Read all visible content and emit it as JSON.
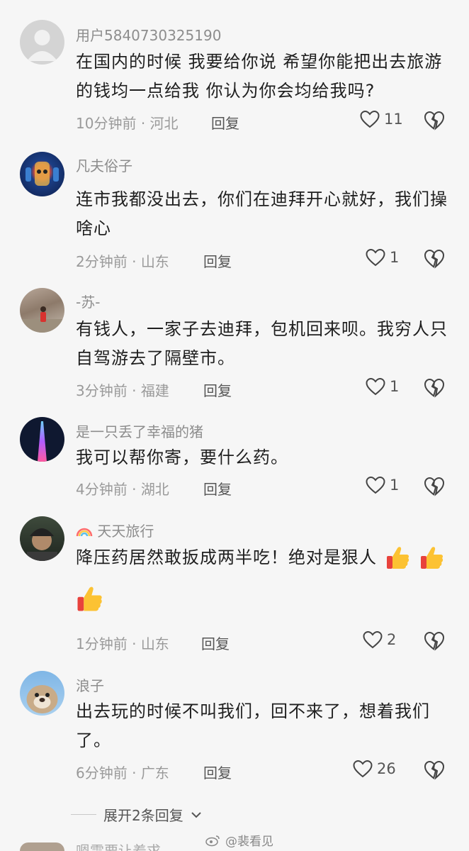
{
  "comments": [
    {
      "user": "用户5840730325190",
      "text": "在国内的时候  我要给你说  希望你能把出去旅游的钱均一点给我  你认为你会均给我吗?",
      "time": "10分钟前",
      "location": "河北",
      "reply": "回复",
      "likes": "11"
    },
    {
      "user": "凡夫俗子",
      "text": "连市我都没出去，你们在迪拜开心就好，我们操啥心",
      "time": "2分钟前",
      "location": "山东",
      "reply": "回复",
      "likes": "1"
    },
    {
      "user": "-苏-",
      "text": "有钱人，一家子去迪拜，包机回来呗。我穷人只自驾游去了隔壁市。",
      "time": "3分钟前",
      "location": "福建",
      "reply": "回复",
      "likes": "1"
    },
    {
      "user": "是一只丢了幸福的猪",
      "text": "我可以帮你寄，要什么药。",
      "time": "4分钟前",
      "location": "湖北",
      "reply": "回复",
      "likes": "1"
    },
    {
      "user": "天天旅行",
      "text": "降压药居然敢扳成两半吃！绝对是狠人",
      "time": "1分钟前",
      "location": "山东",
      "reply": "回复",
      "likes": "2"
    },
    {
      "user": "浪子",
      "text": "出去玩的时候不叫我们，回不来了，想着我们了。",
      "time": "6分钟前",
      "location": "广东",
      "reply": "回复",
      "likes": "26"
    }
  ],
  "more_replies": "展开2条回复",
  "watermark": "@裴看见",
  "partial_next": "嗯需要让着求",
  "colors": {
    "background": "#f6f6f6",
    "text": "#1f1f1f",
    "meta": "#9a9a9a"
  }
}
